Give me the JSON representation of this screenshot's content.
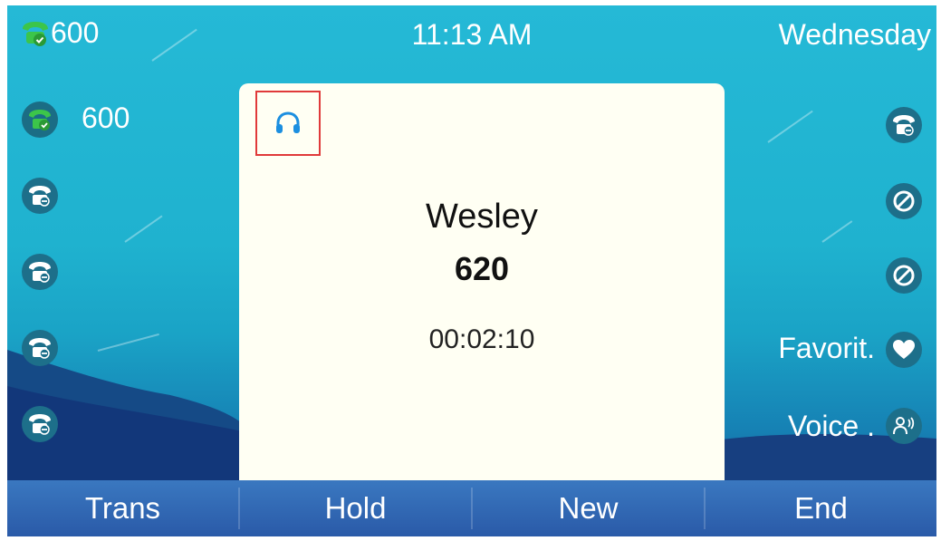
{
  "status_bar": {
    "extension": "600",
    "time": "11:13 AM",
    "day": "Wednesday"
  },
  "left_keys": {
    "line1_label": "600"
  },
  "right_keys": {
    "favorites_label": "Favorit.",
    "voice_label": "Voice ."
  },
  "call": {
    "name": "Wesley",
    "number": "620",
    "duration": "00:02:10",
    "audio_device_icon": "headset-icon"
  },
  "softkeys": [
    "Trans",
    "Hold",
    "New",
    "End"
  ],
  "colors": {
    "background_top": "#25b9d6",
    "card": "#fffff3",
    "softkey_bar": "#2a5aa8",
    "headset_icon": "#1c8fe0",
    "registered_green": "#3cc54a",
    "highlight_box": "#e03a3a"
  }
}
